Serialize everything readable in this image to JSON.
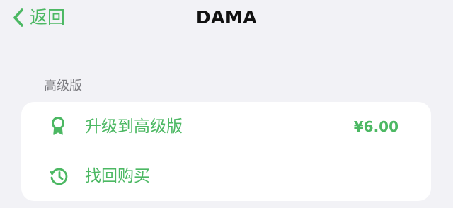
{
  "nav": {
    "back_label": "返回",
    "title": "DAMA"
  },
  "section": {
    "header": "高级版"
  },
  "items": [
    {
      "label": "升级到高级版",
      "price": "¥6.00",
      "icon": "award-ribbon-icon"
    },
    {
      "label": "找回购买",
      "icon": "history-clock-icon"
    }
  ],
  "colors": {
    "accent": "#4cb863",
    "background": "#f2f2f6",
    "card": "#ffffff",
    "secondary_text": "#7d7d82"
  }
}
